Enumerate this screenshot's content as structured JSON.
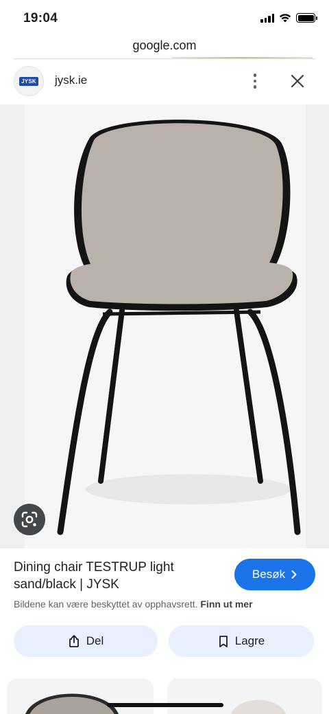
{
  "status_bar": {
    "time": "19:04"
  },
  "browser": {
    "url": "google.com"
  },
  "source": {
    "logo_text": "JYSK",
    "site": "jysk.ie"
  },
  "product": {
    "title": "Dining chair TESTRUP light sand/black | JYSK",
    "copyright_notice": "Bildene kan være beskyttet av opphavsrett.",
    "learn_more": "Finn ut mer"
  },
  "actions": {
    "visit": "Besøk",
    "share": "Del",
    "save": "Lagre"
  },
  "colors": {
    "accent": "#1a73e8",
    "chip_bg": "#e8f0fe",
    "chair_fabric": "#b8b2ab",
    "chair_frame": "#141414"
  }
}
